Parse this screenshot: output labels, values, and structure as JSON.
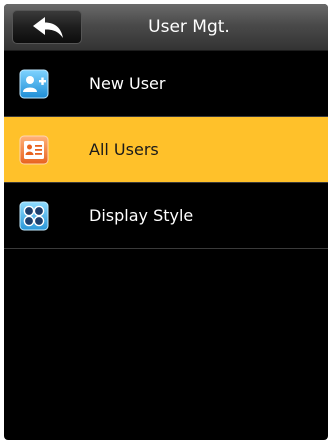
{
  "header": {
    "title": "User Mgt.",
    "back_icon": "back-arrow-icon"
  },
  "menu": {
    "items": [
      {
        "label": "New User",
        "icon": "add-user-icon",
        "selected": false
      },
      {
        "label": "All Users",
        "icon": "user-list-icon",
        "selected": true
      },
      {
        "label": "Display Style",
        "icon": "display-style-icon",
        "selected": false
      }
    ]
  },
  "colors": {
    "selected_background": "#ffc12a",
    "screen_background": "#000000",
    "title_text": "#ffffff"
  }
}
